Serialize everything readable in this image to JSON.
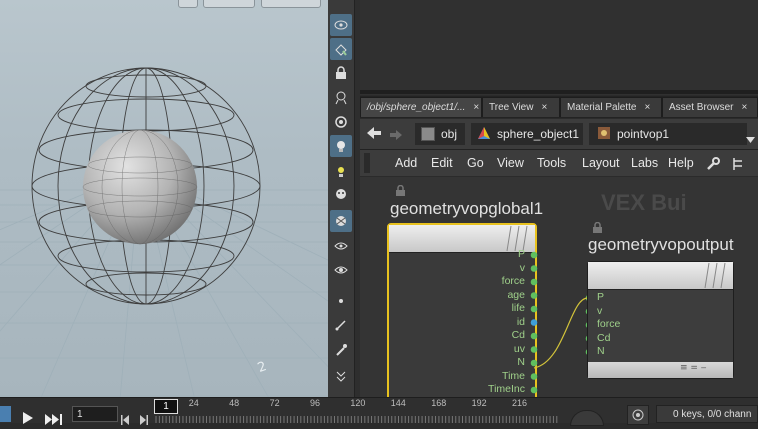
{
  "viewport": {
    "axis_label": "2"
  },
  "network": {
    "tabs": [
      {
        "label": "/obj/sphere_object1/...",
        "close": "×"
      },
      {
        "label": "Tree View",
        "close": "×"
      },
      {
        "label": "Material Palette",
        "close": "×"
      },
      {
        "label": "Asset Browser",
        "close": "×"
      }
    ],
    "path": {
      "crumbs": [
        "obj",
        "sphere_object1",
        "pointvop1"
      ]
    },
    "menu": [
      "Add",
      "Edit",
      "Go",
      "View",
      "Tools",
      "Layout",
      "Labs",
      "Help"
    ],
    "watermark": "VEX Bui",
    "nodes": {
      "global": {
        "name": "geometryvopglobal1",
        "outputs": [
          "P",
          "v",
          "force",
          "age",
          "life",
          "id",
          "Cd",
          "uv",
          "N",
          "Time",
          "TimeInc"
        ]
      },
      "output": {
        "name": "geometryvopoutput",
        "inputs": [
          "P",
          "v",
          "force",
          "Cd",
          "N"
        ]
      }
    }
  },
  "timeline": {
    "current_frame": "1",
    "marker_frame": "1",
    "ticks": [
      "24",
      "48",
      "72",
      "96",
      "120",
      "144",
      "168",
      "192",
      "216"
    ],
    "keys_status": "0 keys, 0/0 chann"
  },
  "colors": {
    "selected_node_outline": "#e8c21f",
    "port_green": "#5fbf5f",
    "port_blue": "#3f9fd8",
    "toolbar_active": "#4e6f87"
  }
}
